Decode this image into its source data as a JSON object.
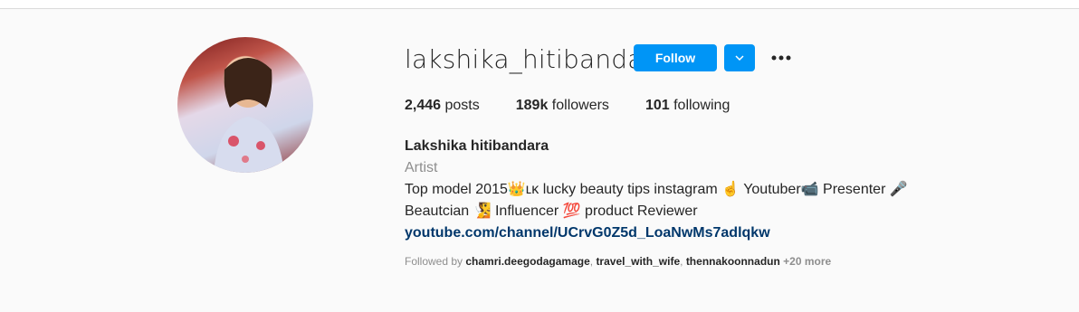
{
  "profile": {
    "username": "lakshika_hitibandara",
    "follow_label": "Follow",
    "stats": {
      "posts_count": "2,446",
      "posts_label": "posts",
      "followers_count": "189k",
      "followers_label": "followers",
      "following_count": "101",
      "following_label": "following"
    },
    "bio": {
      "full_name": "Lakshika hitibandara",
      "category": "Artist",
      "line1": "Top model 2015👑ʟᴋ lucky beauty tips instagram ☝️ Youtuber📹 Presenter 🎤",
      "line2": "Beautcian 🧏 Influencer 💯 product Reviewer",
      "link": "youtube.com/channel/UCrvG0Z5d_LoaNwMs7adlqkw"
    },
    "followed_by": {
      "prefix": "Followed by",
      "users": [
        "chamri.deegodagamage",
        "travel_with_wife",
        "thennakoonnadun"
      ],
      "more": "+20 more"
    }
  },
  "icons": {
    "dropdown": "chevron-down-icon",
    "more": "more-options-icon"
  },
  "colors": {
    "accent": "#0095f6",
    "link": "#00376b",
    "muted": "#8e8e8e"
  }
}
